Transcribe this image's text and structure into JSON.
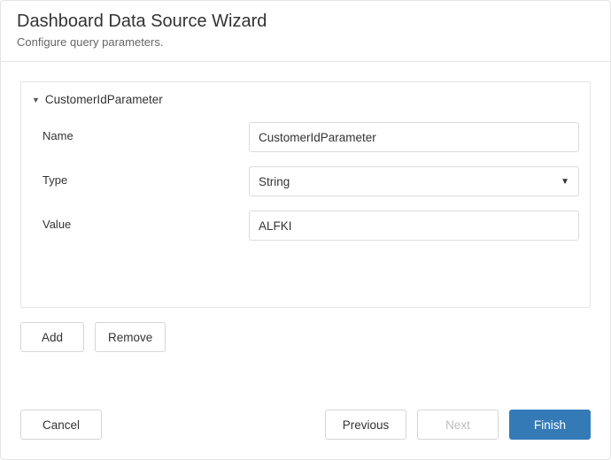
{
  "header": {
    "title": "Dashboard Data Source Wizard",
    "subtitle": "Configure query parameters."
  },
  "parameter": {
    "section_title": "CustomerIdParameter",
    "name_label": "Name",
    "name_value": "CustomerIdParameter",
    "type_label": "Type",
    "type_value": "String",
    "value_label": "Value",
    "value_value": "ALFKI"
  },
  "actions": {
    "add": "Add",
    "remove": "Remove"
  },
  "footer": {
    "cancel": "Cancel",
    "previous": "Previous",
    "next": "Next",
    "finish": "Finish"
  }
}
